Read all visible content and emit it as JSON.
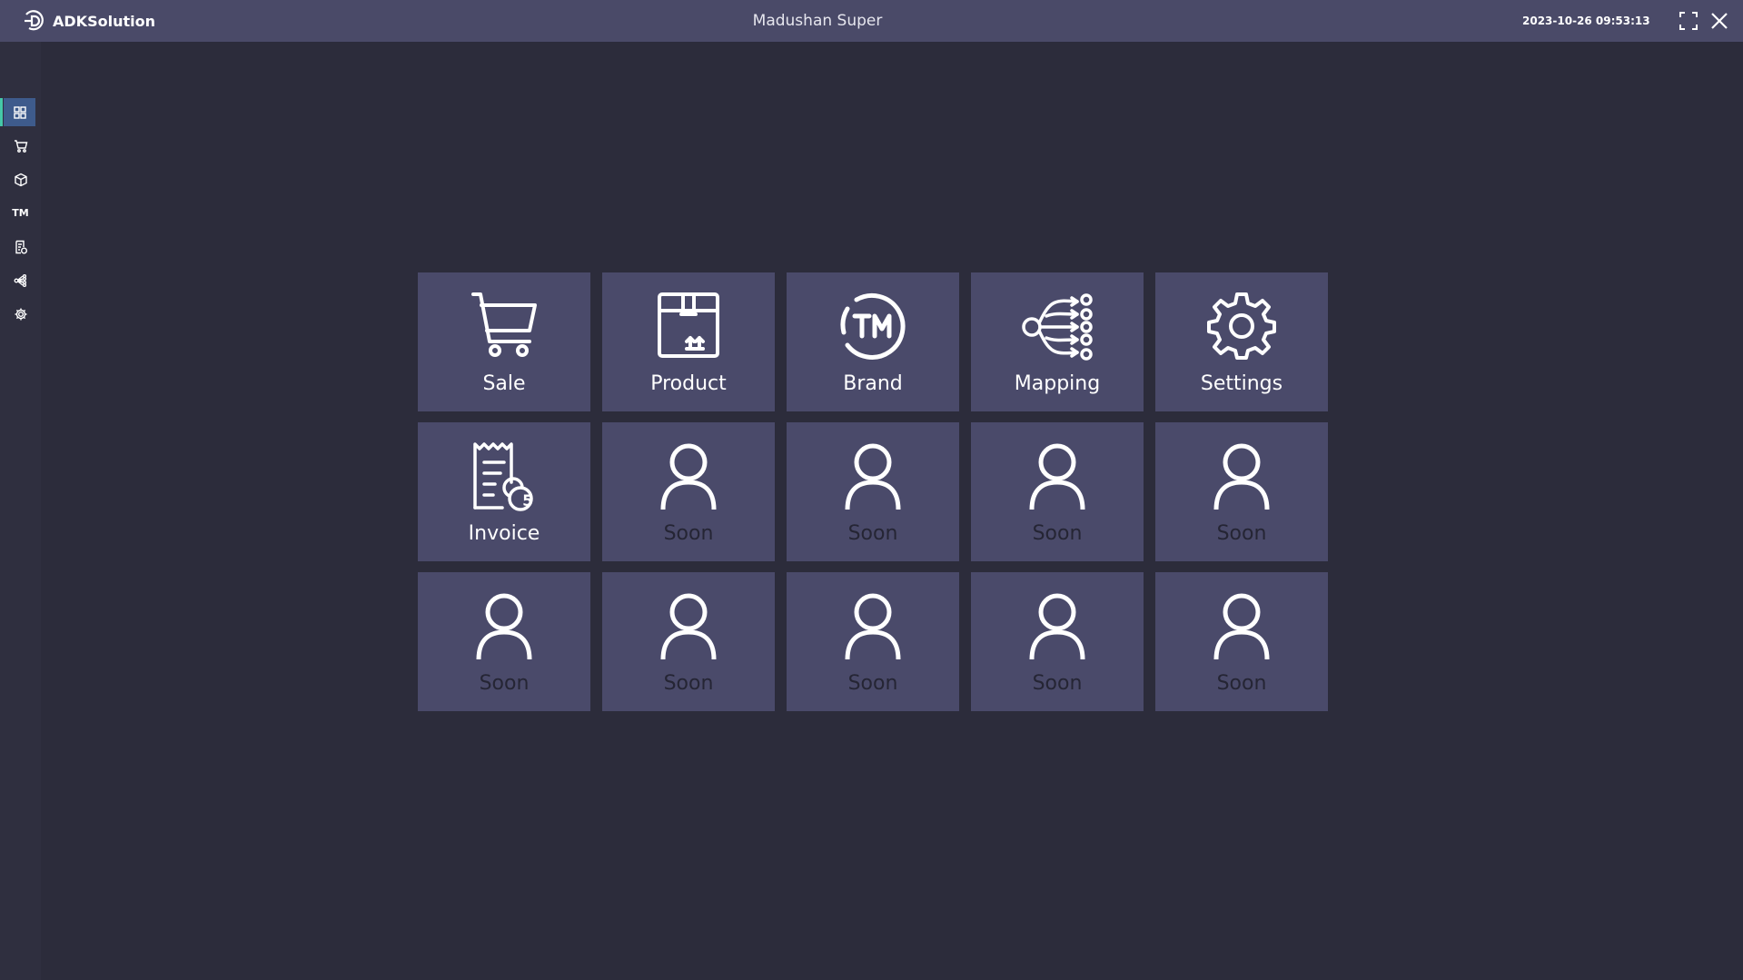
{
  "app": {
    "brand_name": "ADKSolution",
    "window_title": "Madushan Super",
    "datetime": "2023-10-26 09:53:13"
  },
  "titlebar_controls": {
    "maximize_icon": "maximize-icon",
    "close_icon": "close-icon"
  },
  "sidebar": {
    "items": [
      {
        "name": "dashboard",
        "icon": "grid-icon",
        "active": true
      },
      {
        "name": "sale",
        "icon": "cart-icon",
        "active": false
      },
      {
        "name": "product",
        "icon": "box-icon",
        "active": false
      },
      {
        "name": "brand",
        "icon": "trademark-icon",
        "label": "TM",
        "active": false
      },
      {
        "name": "invoice",
        "icon": "invoice-icon",
        "active": false
      },
      {
        "name": "mapping",
        "icon": "mapping-icon",
        "active": false
      },
      {
        "name": "settings",
        "icon": "gear-icon",
        "active": false
      }
    ]
  },
  "tiles": [
    {
      "label": "Sale",
      "icon": "cart-icon"
    },
    {
      "label": "Product",
      "icon": "box-icon"
    },
    {
      "label": "Brand",
      "icon": "trademark-icon"
    },
    {
      "label": "Mapping",
      "icon": "mapping-icon"
    },
    {
      "label": "Settings",
      "icon": "gear-icon"
    },
    {
      "label": "Invoice",
      "icon": "invoice-icon"
    },
    {
      "label": "Soon",
      "icon": "user-icon"
    },
    {
      "label": "Soon",
      "icon": "user-icon"
    },
    {
      "label": "Soon",
      "icon": "user-icon"
    },
    {
      "label": "Soon",
      "icon": "user-icon"
    },
    {
      "label": "Soon",
      "icon": "user-icon"
    },
    {
      "label": "Soon",
      "icon": "user-icon"
    },
    {
      "label": "Soon",
      "icon": "user-icon"
    },
    {
      "label": "Soon",
      "icon": "user-icon"
    },
    {
      "label": "Soon",
      "icon": "user-icon"
    }
  ],
  "invoice_badge": "5",
  "colors": {
    "titlebar_bg": "#4a4a68",
    "app_bg": "#2c2c3b",
    "tile_bg": "#4a4a6a",
    "sidebar_active_bg": "#3e5b8c",
    "sidebar_active_accent": "#45c8a9",
    "soon_label": "#252534"
  }
}
